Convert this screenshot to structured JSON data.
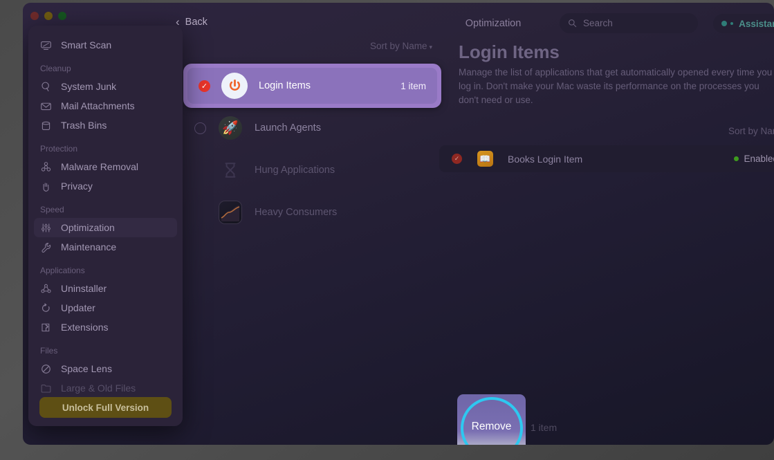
{
  "window": {
    "traffic_lights": [
      "close",
      "minimize",
      "zoom"
    ],
    "back_label": "Back",
    "section_title": "Optimization"
  },
  "search": {
    "placeholder": "Search",
    "icon": "search-icon"
  },
  "assistant": {
    "label": "Assistant",
    "accent": "#2f7d78"
  },
  "sidebar": {
    "top_item": {
      "label": "Smart Scan",
      "icon": "monitor-icon"
    },
    "groups": [
      {
        "title": "Cleanup",
        "items": [
          {
            "label": "System Junk",
            "icon": "brush-icon"
          },
          {
            "label": "Mail Attachments",
            "icon": "mail-icon"
          },
          {
            "label": "Trash Bins",
            "icon": "trash-icon"
          }
        ]
      },
      {
        "title": "Protection",
        "items": [
          {
            "label": "Malware Removal",
            "icon": "biohazard-icon"
          },
          {
            "label": "Privacy",
            "icon": "hand-icon"
          }
        ]
      },
      {
        "title": "Speed",
        "items": [
          {
            "label": "Optimization",
            "icon": "sliders-icon",
            "active": true
          },
          {
            "label": "Maintenance",
            "icon": "wrench-icon"
          }
        ]
      },
      {
        "title": "Applications",
        "items": [
          {
            "label": "Uninstaller",
            "icon": "uninstall-icon"
          },
          {
            "label": "Updater",
            "icon": "refresh-icon"
          },
          {
            "label": "Extensions",
            "icon": "puzzle-icon"
          }
        ]
      },
      {
        "title": "Files",
        "items": [
          {
            "label": "Space Lens",
            "icon": "lens-icon"
          },
          {
            "label": "Large & Old Files",
            "icon": "folder-icon",
            "faded": true
          }
        ]
      }
    ],
    "unlock_label": "Unlock Full Version"
  },
  "middle": {
    "sort_label": "Sort by Name",
    "sort_caret": "▾",
    "cards": [
      {
        "name": "Login Items",
        "count": "1 item",
        "icon": "power-icon",
        "checked": true,
        "selected": true
      },
      {
        "name": "Launch Agents",
        "count": "",
        "icon": "rocket-icon",
        "checked": false,
        "selected": false
      },
      {
        "name": "Hung Applications",
        "count": "",
        "icon": "hourglass-icon",
        "checked": null,
        "selected": false
      },
      {
        "name": "Heavy Consumers",
        "count": "",
        "icon": "chart-icon",
        "checked": null,
        "selected": false
      }
    ]
  },
  "detail": {
    "title": "Login Items",
    "description": "Manage the list of applications that get automatically opened every time you log in. Don't make your Mac waste its performance on the processes you don't need or use.",
    "sort_label": "Sort by Name",
    "sort_caret": "▾",
    "rows": [
      {
        "name": "Books Login Item",
        "icon": "book-icon",
        "checked": true,
        "status": "Enabled",
        "status_color": "#3e9b1e"
      }
    ]
  },
  "footer": {
    "action_label": "Remove",
    "count_label": "1 item"
  },
  "colors": {
    "selection_purple": "#8b72bb",
    "checkbox_red": "#e8342a",
    "click_ring_cyan": "#2ec8f0",
    "unlock_gold": "#5e4f14"
  }
}
